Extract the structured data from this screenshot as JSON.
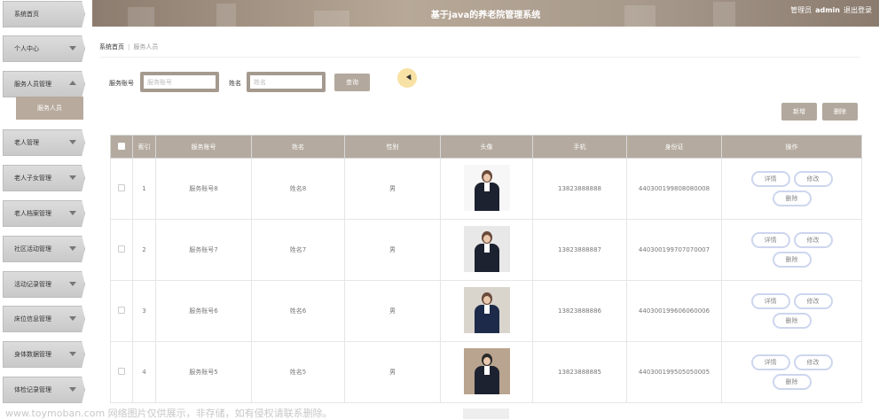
{
  "header": {
    "title": "基于java的养老院管理系统",
    "role_label": "管理员",
    "username": "admin",
    "logout_label": "退出登录"
  },
  "sidebar": {
    "items": [
      {
        "label": "系统首页",
        "expanded": false
      },
      {
        "label": "个人中心",
        "expanded": false
      },
      {
        "label": "服务人员管理",
        "expanded": true,
        "children": [
          "服务人员"
        ]
      },
      {
        "label": "老人管理",
        "expanded": false
      },
      {
        "label": "老人子女管理",
        "expanded": false
      },
      {
        "label": "老人档案管理",
        "expanded": false
      },
      {
        "label": "社区活动管理",
        "expanded": false
      },
      {
        "label": "活动记录管理",
        "expanded": false
      },
      {
        "label": "床位信息管理",
        "expanded": false
      },
      {
        "label": "身体数据管理",
        "expanded": false
      },
      {
        "label": "体检记录管理",
        "expanded": false
      }
    ]
  },
  "breadcrumb": {
    "home": "系统首页",
    "current": "服务人员"
  },
  "search": {
    "account_label": "服务账号",
    "account_placeholder": "服务账号",
    "name_label": "姓名",
    "name_placeholder": "姓名",
    "query_button": "查询"
  },
  "actions": {
    "add": "新增",
    "delete": "删除"
  },
  "table": {
    "headers": [
      "索引",
      "服务账号",
      "姓名",
      "性别",
      "头像",
      "手机",
      "身份证",
      "操作"
    ],
    "row_actions": {
      "detail": "详情",
      "edit": "修改",
      "delete": "删除"
    },
    "rows": [
      {
        "index": "1",
        "account": "服务账号8",
        "name": "姓名8",
        "gender": "男",
        "phone": "13823888888",
        "id_card": "440300199808080008"
      },
      {
        "index": "2",
        "account": "服务账号7",
        "name": "姓名7",
        "gender": "男",
        "phone": "13823888887",
        "id_card": "440300199707070007"
      },
      {
        "index": "3",
        "account": "服务账号6",
        "name": "姓名6",
        "gender": "男",
        "phone": "13823888886",
        "id_card": "440300199606060006"
      },
      {
        "index": "4",
        "account": "服务账号5",
        "name": "姓名5",
        "gender": "男",
        "phone": "13823888885",
        "id_card": "440300199505050005"
      }
    ]
  },
  "watermark": "www.toymoban.com 网络图片仅供展示，非存储，如有侵权请联系删除。",
  "colors": {
    "accent": "#b4aa9f",
    "header": "#a7998b",
    "button_border": "#cdd6ee"
  }
}
